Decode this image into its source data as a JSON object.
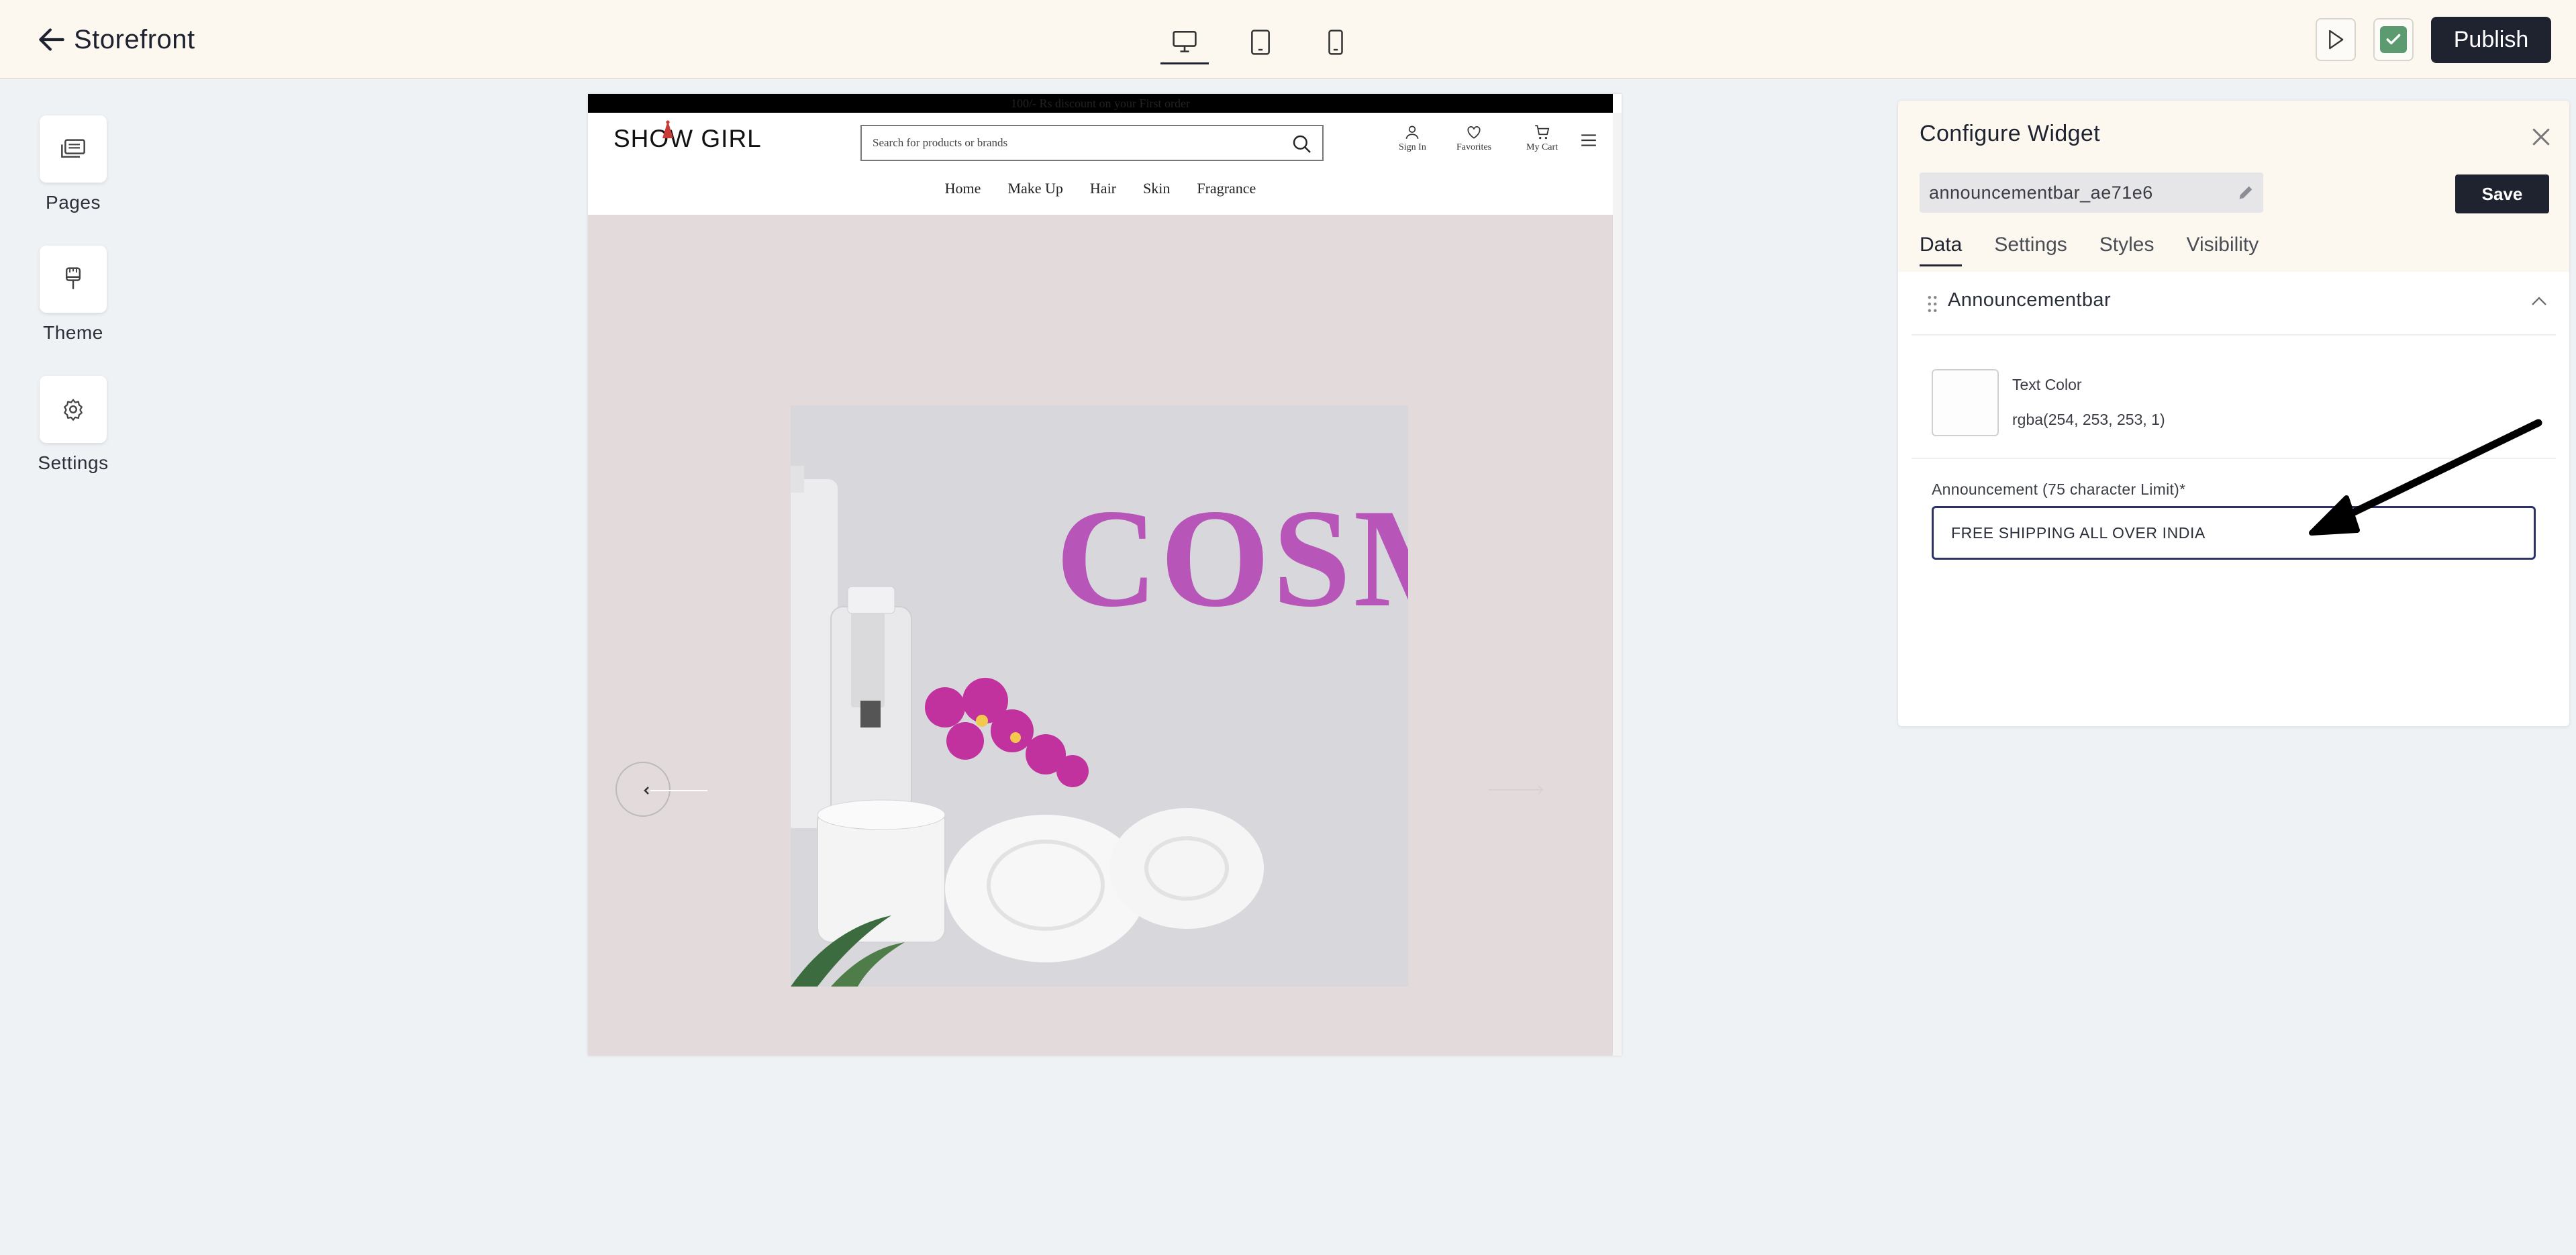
{
  "header": {
    "title": "Storefront",
    "publish_label": "Publish",
    "devices": [
      "desktop",
      "tablet",
      "mobile"
    ],
    "active_device": "desktop"
  },
  "sidebar": {
    "items": [
      {
        "label": "Pages",
        "icon": "pages-icon"
      },
      {
        "label": "Theme",
        "icon": "brush-icon"
      },
      {
        "label": "Settings",
        "icon": "gear-icon"
      }
    ]
  },
  "preview": {
    "announcement_text": "100/- Rs discount on your First order",
    "logo": "SHOW GIRL",
    "search_placeholder": "Search for products or brands",
    "actions": [
      "Sign In",
      "Favorites",
      "My Cart"
    ],
    "nav": [
      "Home",
      "Make Up",
      "Hair",
      "Skin",
      "Fragrance"
    ],
    "hero_word": "COSM"
  },
  "panel": {
    "title": "Configure Widget",
    "widget_name": "announcementbar_ae71e6",
    "save_label": "Save",
    "tabs": [
      "Data",
      "Settings",
      "Styles",
      "Visibility"
    ],
    "active_tab": "Data",
    "section_title": "Announcementbar",
    "text_color_label": "Text Color",
    "text_color_value": "rgba(254, 253, 253, 1)",
    "announcement_label": "Announcement (75 character Limit)*",
    "announcement_value": "FREE SHIPPING ALL OVER INDIA"
  },
  "colors": {
    "accent_dark": "#1f2330",
    "header_bg": "#fcf8ef",
    "publish_check": "#5c9a6f",
    "input_border": "#2c3266",
    "hero_text": "#b756b8"
  }
}
